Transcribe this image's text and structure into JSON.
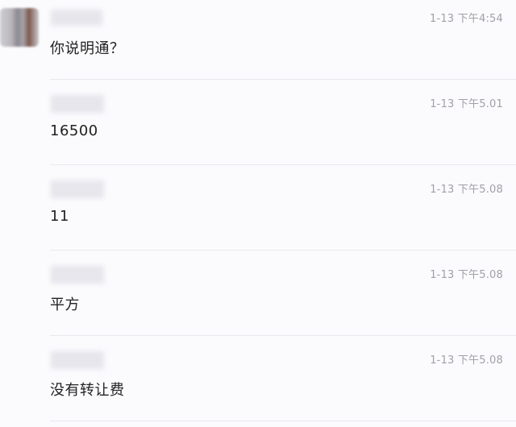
{
  "messages": [
    {
      "time": "1-13 下午4:54",
      "text": "你说明通？"
    },
    {
      "time": "1-13 下午5.01",
      "text": "16500"
    },
    {
      "time": "1-13 下午5.08",
      "text": "11"
    },
    {
      "time": "1-13 下午5.08",
      "text": "平方"
    },
    {
      "time": "1-13 下午5.08",
      "text": "没有转让费"
    }
  ]
}
